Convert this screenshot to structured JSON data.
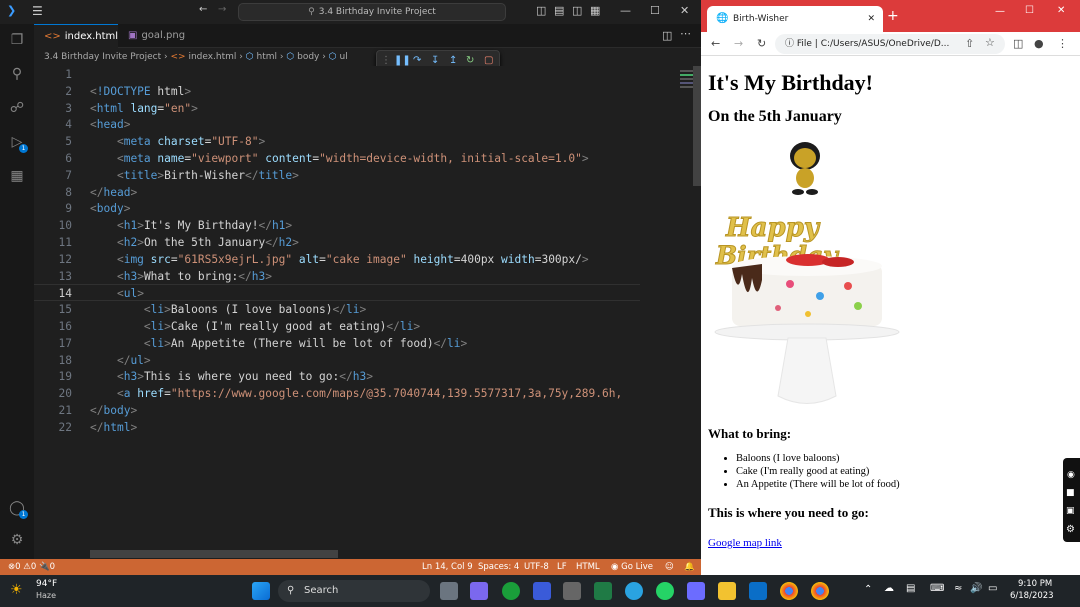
{
  "vscode": {
    "title": "3.4 Birthday Invite Project",
    "tabs": [
      {
        "label": "index.html",
        "active": true
      },
      {
        "label": "goal.png",
        "active": false
      }
    ],
    "breadcrumb": [
      "3.4 Birthday Invite Project",
      "index.html",
      "html",
      "body",
      "ul"
    ],
    "lines": [
      {
        "n": "1",
        "code": ""
      },
      {
        "n": "2",
        "code": "<!DOCTYPE html>"
      },
      {
        "n": "3",
        "code": "<html lang=\"en\">"
      },
      {
        "n": "4",
        "code": "<head>"
      },
      {
        "n": "5",
        "code": "    <meta charset=\"UTF-8\">"
      },
      {
        "n": "6",
        "code": "    <meta name=\"viewport\" content=\"width=device-width, initial-scale=1.0\">"
      },
      {
        "n": "7",
        "code": "    <title>Birth-Wisher</title>"
      },
      {
        "n": "8",
        "code": "</head>"
      },
      {
        "n": "9",
        "code": "<body>"
      },
      {
        "n": "10",
        "code": "    <h1>It's My Birthday!</h1>"
      },
      {
        "n": "11",
        "code": "    <h2>On the 5th January</h2>"
      },
      {
        "n": "12",
        "code": "    <img src=\"61RS5x9ejrL.jpg\" alt=\"cake image\" height=400px width=300px/>"
      },
      {
        "n": "13",
        "code": "    <h3>What to bring:</h3>"
      },
      {
        "n": "14",
        "code": "    <ul>"
      },
      {
        "n": "15",
        "code": "        <li>Baloons (I love baloons)</li>"
      },
      {
        "n": "16",
        "code": "        <li>Cake (I'm really good at eating)</li>"
      },
      {
        "n": "17",
        "code": "        <li>An Appetite (There will be lot of food)</li>"
      },
      {
        "n": "18",
        "code": "    </ul>"
      },
      {
        "n": "19",
        "code": "    <h3>This is where you need to go:</h3>"
      },
      {
        "n": "20",
        "code": "    <a href=\"https://www.google.com/maps/@35.7040744,139.5577317,3a,75y,289.6h,"
      },
      {
        "n": "21",
        "code": "</body>"
      },
      {
        "n": "22",
        "code": "</html>"
      }
    ],
    "current_line": "14",
    "status": {
      "errors": "0",
      "warnings": "0",
      "ports": "0",
      "cursor": "Ln 14, Col 9",
      "spaces": "Spaces: 4",
      "encoding": "UTF-8",
      "eol": "LF",
      "language": "HTML",
      "golive": "Go Live"
    },
    "account_badge": "1",
    "ext_badge": "1"
  },
  "chrome": {
    "tab_title": "Birth-Wisher",
    "address": "File  |  C:/Users/ASUS/OneDrive/D...",
    "page": {
      "h1": "It's My Birthday!",
      "h2": "On the 5th January",
      "cake_text": "Happy Birthday",
      "h3_bring": "What to bring:",
      "items": [
        "Baloons (I love baloons)",
        "Cake (I'm really good at eating)",
        "An Appetite (There will be lot of food)"
      ],
      "h3_where": "This is where you need to go:",
      "link": "Google map link"
    }
  },
  "taskbar": {
    "weather_temp": "94°F",
    "weather_desc": "Haze",
    "search": "Search",
    "time": "9:10 PM",
    "date": "6/18/2023"
  },
  "colors": {
    "statusbar": "#cc6633",
    "chrome_frame": "#dc3b3b",
    "accent": "#0078d4"
  }
}
